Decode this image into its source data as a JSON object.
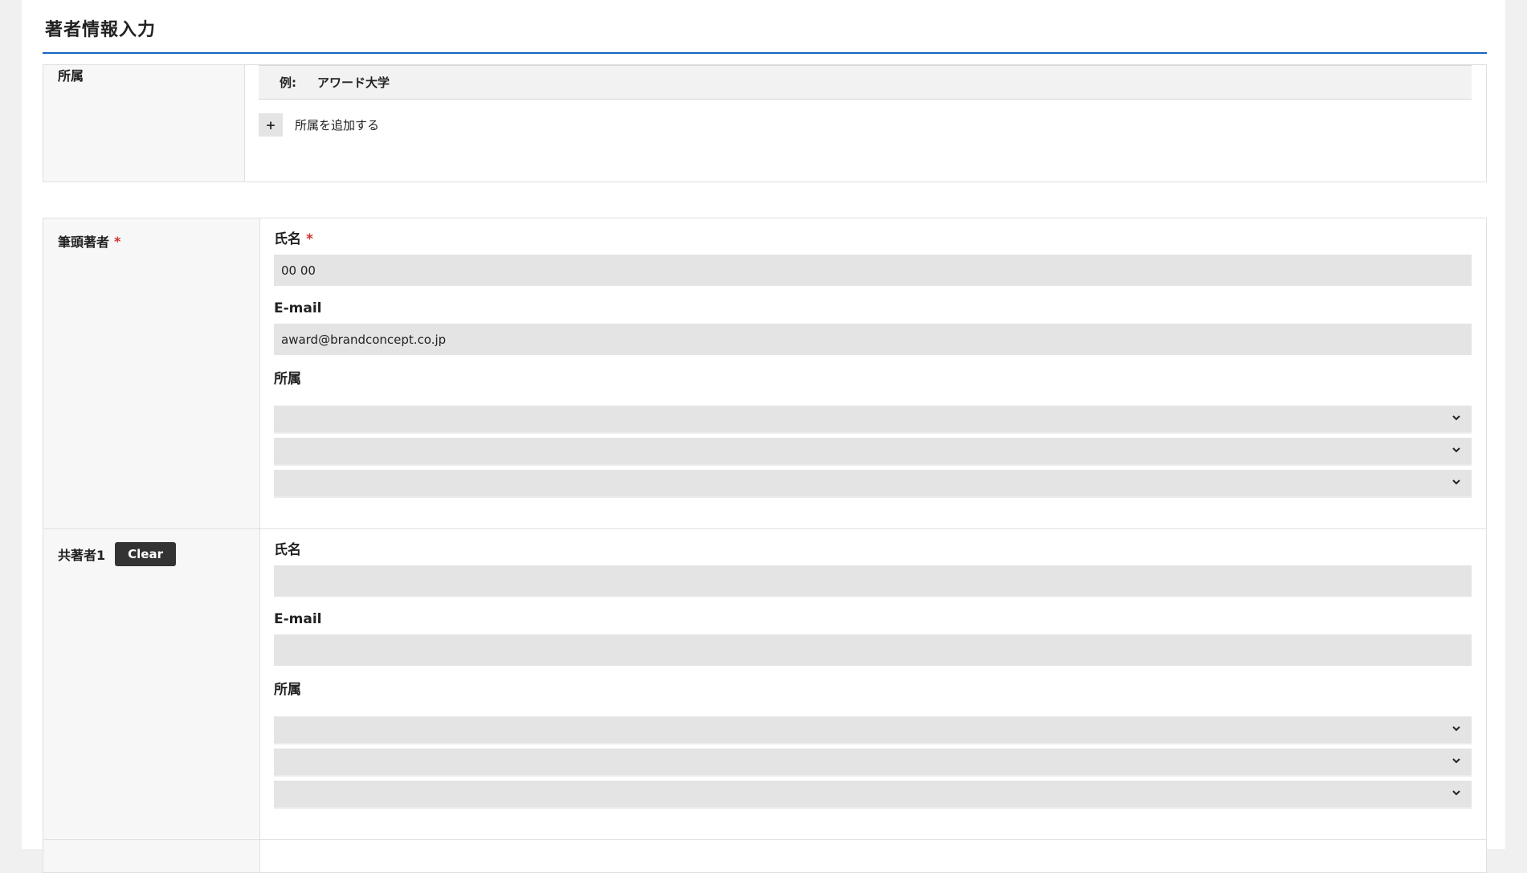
{
  "section": {
    "title": "著者情報入力"
  },
  "affiliation": {
    "heading": "所属",
    "example_label": "例:",
    "example_value": "アワード大学",
    "add_button_icon": "+",
    "add_label": "所属を追加する"
  },
  "lead_author": {
    "heading": "筆頭著者",
    "required_mark": "*",
    "name_label": "氏名",
    "name_required_mark": "*",
    "name_value": "00 00",
    "email_label": "E-mail",
    "email_value": "award@brandconcept.co.jp",
    "affiliation_label": "所属",
    "affiliation_selects": [
      "",
      "",
      ""
    ]
  },
  "co_author_1": {
    "heading": "共著者1",
    "clear_button": "Clear",
    "name_label": "氏名",
    "name_value": "",
    "email_label": "E-mail",
    "email_value": "",
    "affiliation_label": "所属",
    "affiliation_selects": [
      "",
      "",
      ""
    ]
  },
  "icons": {
    "select_arrow": "chevron-down-icon",
    "add": "plus-icon"
  },
  "colors": {
    "accent_line": "#1565c0",
    "required": "#d32f2f",
    "clear_button_bg": "#333333",
    "input_bg": "#e4e4e4"
  }
}
